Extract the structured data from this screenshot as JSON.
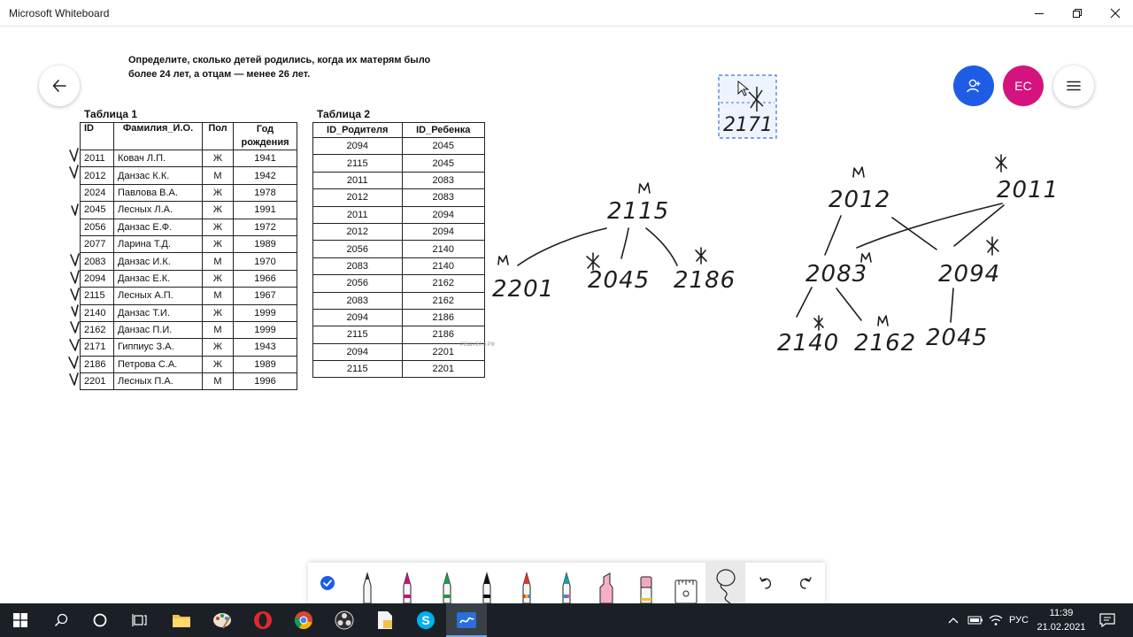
{
  "window": {
    "title": "Microsoft Whiteboard"
  },
  "task": {
    "line1": "Определите, сколько детей родились, когда их матерям было",
    "line2": "более 24 лет, а отцам — менее 26 лет."
  },
  "table1": {
    "caption": "Таблица 1",
    "headers": [
      "ID",
      "Фамилия_И.О.",
      "Пол",
      "Год рождения"
    ],
    "rows": [
      [
        "2011",
        "Ковач Л.П.",
        "Ж",
        "1941"
      ],
      [
        "2012",
        "Данзас К.К.",
        "М",
        "1942"
      ],
      [
        "2024",
        "Павлова В.А.",
        "Ж",
        "1978"
      ],
      [
        "2045",
        "Лесных Л.А.",
        "Ж",
        "1991"
      ],
      [
        "2056",
        "Данзас Е.Ф.",
        "Ж",
        "1972"
      ],
      [
        "2077",
        "Ларина Т.Д.",
        "Ж",
        "1989"
      ],
      [
        "2083",
        "Данзас И.К.",
        "М",
        "1970"
      ],
      [
        "2094",
        "Данзас Е.К.",
        "Ж",
        "1966"
      ],
      [
        "2115",
        "Лесных А.П.",
        "М",
        "1967"
      ],
      [
        "2140",
        "Данзас Т.И.",
        "Ж",
        "1999"
      ],
      [
        "2162",
        "Данзас П.И.",
        "М",
        "1999"
      ],
      [
        "2171",
        "Гиппиус З.А.",
        "Ж",
        "1943"
      ],
      [
        "2186",
        "Петрова С.А.",
        "Ж",
        "1989"
      ],
      [
        "2201",
        "Лесных П.А.",
        "М",
        "1996"
      ]
    ]
  },
  "table2": {
    "caption": "Таблица 2",
    "headers": [
      "ID_Родителя",
      "ID_Ребенка"
    ],
    "rows": [
      [
        "2094",
        "2045"
      ],
      [
        "2115",
        "2045"
      ],
      [
        "2011",
        "2083"
      ],
      [
        "2012",
        "2083"
      ],
      [
        "2011",
        "2094"
      ],
      [
        "2012",
        "2094"
      ],
      [
        "2056",
        "2140"
      ],
      [
        "2083",
        "2140"
      ],
      [
        "2056",
        "2162"
      ],
      [
        "2083",
        "2162"
      ],
      [
        "2094",
        "2186"
      ],
      [
        "2115",
        "2186"
      ],
      [
        "2094",
        "2201"
      ],
      [
        "2115",
        "2201"
      ]
    ],
    "watermark": "РЕШУЕГЭ.РФ"
  },
  "sketch": {
    "tree1": {
      "root": "2115",
      "root_mark": "м",
      "children": [
        "2201",
        "2045",
        "2186"
      ],
      "child_marks": [
        "м",
        "*",
        "*"
      ]
    },
    "tree2": {
      "parents": [
        "2012",
        "2011"
      ],
      "parent_marks": [
        "м",
        "*"
      ],
      "middle": [
        "2083",
        "2094"
      ],
      "middle_marks": [
        "м",
        "*"
      ],
      "children": [
        "2140",
        "2162",
        "2045"
      ],
      "child_marks": [
        "*",
        "м",
        ""
      ]
    },
    "selection": {
      "label": "2171"
    }
  },
  "buttons": {
    "avatar_initials": "EC"
  },
  "icons": {
    "back": "arrow-left-icon",
    "user": "person-add-icon",
    "menu": "hamburger-icon",
    "minimize": "minimize-icon",
    "restore": "restore-icon",
    "close": "close-icon"
  },
  "toolbar": {
    "tools": [
      "select",
      "pen-white",
      "pen-magenta",
      "pen-green",
      "pen-black",
      "pen-red-rainbow",
      "pen-teal-rainbow",
      "highlighter-pink",
      "eraser",
      "ruler",
      "lasso",
      "undo",
      "redo"
    ],
    "colors": {
      "magenta": "#c0187a",
      "green": "#1f9a4b",
      "black": "#111111",
      "red": "#e0362a",
      "teal": "#1aa0a5",
      "pink": "#f5b0c8",
      "eraser": "#f1a8c0"
    }
  },
  "taskbar": {
    "apps": [
      "windows-start",
      "search",
      "cortana",
      "task-view",
      "file-explorer",
      "paint",
      "opera",
      "chrome",
      "obs",
      "files-document",
      "skype",
      "whiteboard"
    ],
    "language": "РУС",
    "time": "11:39",
    "date": "21.02.2021"
  },
  "accent": {
    "blue": "#1f5ce6",
    "pink": "#d4137f"
  }
}
